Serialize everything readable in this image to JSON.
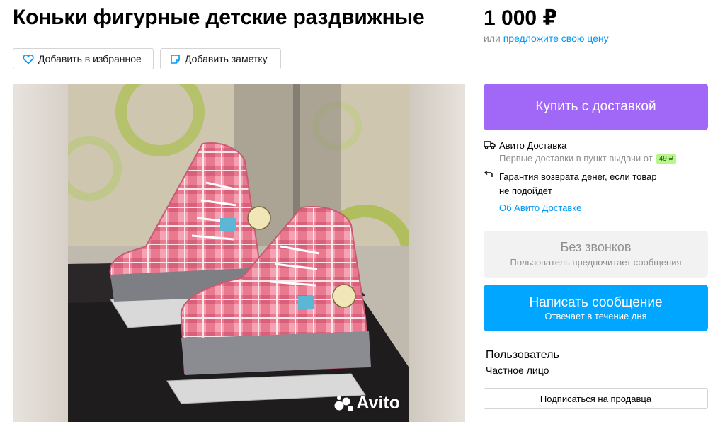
{
  "listing": {
    "title": "Коньки фигурные детские раздвижные",
    "price": "1 000 ₽",
    "price_prefix": "или",
    "offer_link": "предложите свою цену"
  },
  "actions": {
    "favorite_label": "Добавить в избранное",
    "note_label": "Добавить заметку"
  },
  "gallery": {
    "watermark": "Avito"
  },
  "buy": {
    "label": "Купить с доставкой",
    "color": "#a168f7"
  },
  "delivery": {
    "title": "Авито Доставка",
    "subtitle": "Первые доставки в пункт выдачи от",
    "badge": "49 ₽",
    "guarantee_line1": "Гарантия возврата денег, если товар",
    "guarantee_line2": "не подойдёт",
    "about_link": "Об Авито Доставке"
  },
  "no_calls": {
    "title": "Без звонков",
    "subtitle": "Пользователь предпочитает сообщения"
  },
  "message": {
    "label": "Написать сообщение",
    "sublabel": "Отвечает в течение дня",
    "color": "#00a6ff"
  },
  "seller": {
    "name": "Пользователь",
    "type": "Частное лицо",
    "subscribe_label": "Подписаться на продавца"
  },
  "icons": [
    "heart-icon",
    "note-icon",
    "truck-icon",
    "return-icon",
    "avito-logo-icon"
  ]
}
